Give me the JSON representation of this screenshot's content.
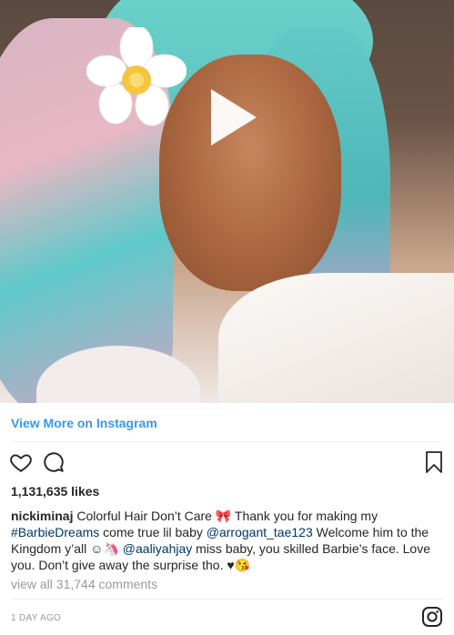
{
  "post": {
    "view_more_label": "View More on Instagram",
    "likes": "1,131,635 likes",
    "caption": {
      "username": "nickiminaj",
      "text_1": " Colorful Hair Don’t Care 🎀 Thank you for making my ",
      "hashtag": "#BarbieDreams",
      "text_2": " come true lil baby ",
      "mention_1": "@arrogant_tae123",
      "text_3": " Welcome him to the Kingdom y’all ☺🦄 ",
      "mention_2": "@aaliyahjay",
      "text_4": " miss baby, you skilled Barbie’s face. Love you. Don’t give away the surprise tho. ♥😘"
    },
    "comments_link": "view all 31,744 comments",
    "timestamp": "1 DAY AGO"
  },
  "icons": {
    "play": "play-icon",
    "like": "heart-icon",
    "comment": "comment-icon",
    "save": "bookmark-icon",
    "brand": "instagram-icon"
  },
  "colors": {
    "link": "#3897f0",
    "mention": "#003569",
    "muted": "#999999"
  }
}
